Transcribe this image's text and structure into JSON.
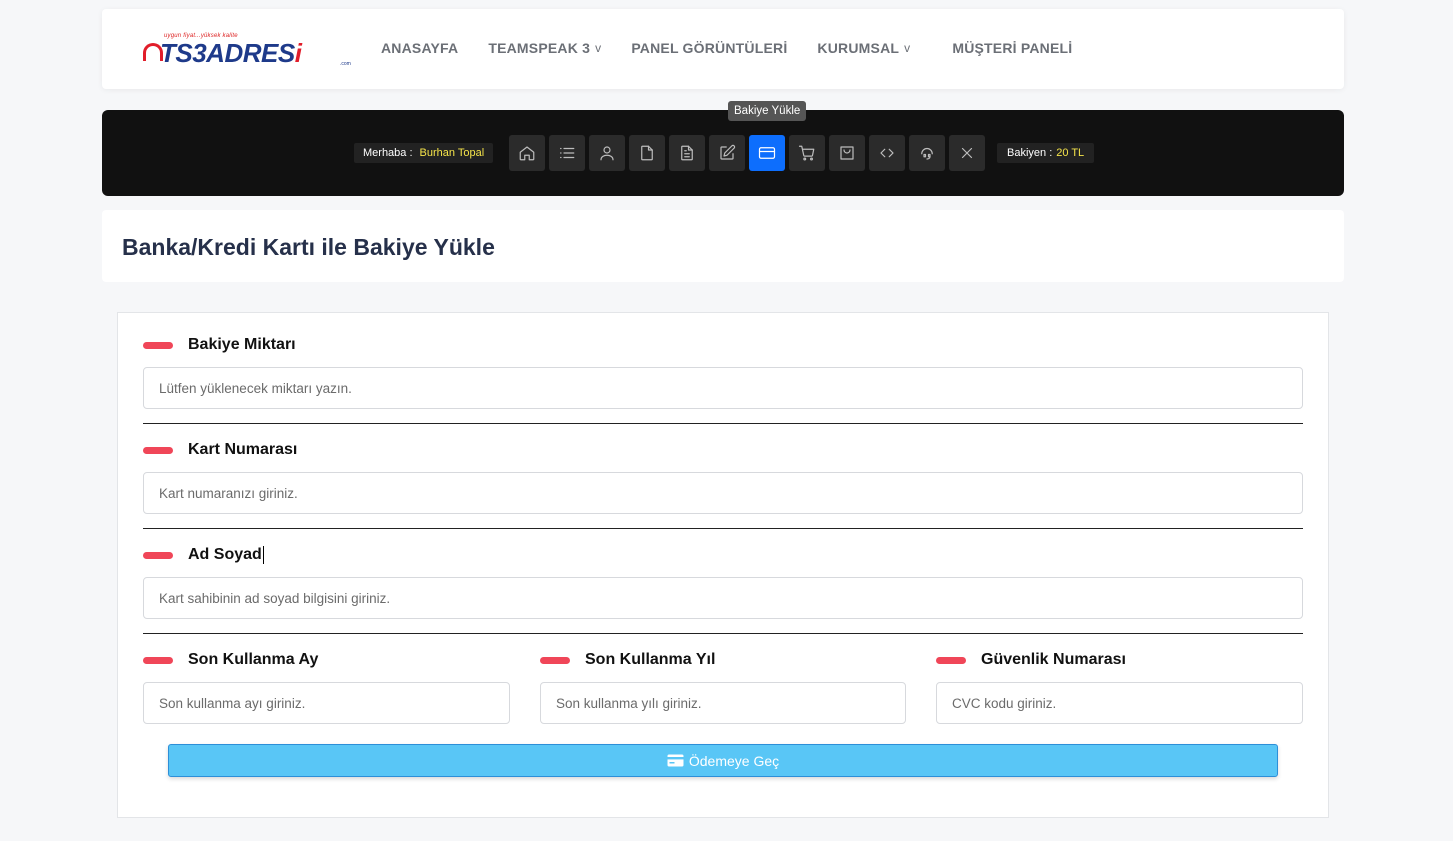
{
  "logo": {
    "tagline": "uygun fiyat...yüksek kalite",
    "text_main": "TS3ADRES",
    "text_accent": "i",
    "suffix": ".com"
  },
  "nav": {
    "home": "ANASAYFA",
    "teamspeak": "TEAMSPEAK 3",
    "panel_screens": "PANEL GÖRÜNTÜLERİ",
    "corporate": "KURUMSAL",
    "customer_panel": "MÜŞTERİ PANELİ",
    "dropdown_glyph": "v"
  },
  "toolbar": {
    "greeting_label": "Merhaba :",
    "user_name": "Burhan Topal",
    "tooltip": "Bakiye Yükle",
    "balance_label": "Bakiyen :",
    "balance_value": "20 TL",
    "tools": [
      "home-icon",
      "list-icon",
      "user-icon",
      "file-icon",
      "document-icon",
      "edit-icon",
      "credit-card-icon",
      "cart-icon",
      "shopping-bag-icon",
      "code-icon",
      "support-icon",
      "close-icon"
    ],
    "active_tool": "credit-card-icon",
    "active_color": "#0d6efd"
  },
  "page": {
    "title": "Banka/Kredi Kartı ile Bakiye Yükle"
  },
  "form": {
    "amount": {
      "label": "Bakiye Miktarı",
      "placeholder": "Lütfen yüklenecek miktarı yazın."
    },
    "card_number": {
      "label": "Kart Numarası",
      "placeholder": "Kart numaranızı giriniz."
    },
    "full_name": {
      "label": "Ad Soyad",
      "placeholder": "Kart sahibinin ad soyad bilgisini giriniz."
    },
    "exp_month": {
      "label": "Son Kullanma Ay",
      "placeholder": "Son kullanma ayı giriniz."
    },
    "exp_year": {
      "label": "Son Kullanma Yıl",
      "placeholder": "Son kullanma yılı giriniz."
    },
    "cvc": {
      "label": "Güvenlik Numarası",
      "placeholder": "CVC kodu giriniz."
    },
    "submit_label": "Ödemeye Geç",
    "accent_color": "#f04658",
    "button_color": "#59c6f6"
  }
}
